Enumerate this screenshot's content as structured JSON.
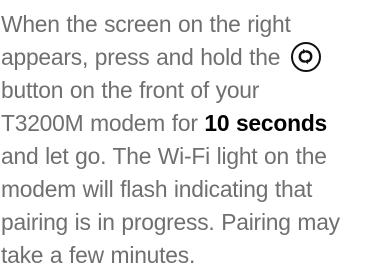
{
  "instructions": {
    "line1": "When the screen on the right",
    "line2": "appears, press and hold the",
    "line3": "button on the front of your",
    "line4_start": "T3200M modem for",
    "line4_bold": "10 seconds",
    "line5": "and let go. The Wi-Fi light on the",
    "line6": "modem will flash indicating that",
    "line7": "pairing is in progress. Pairing may",
    "line8": "take a few minutes."
  },
  "icons": {
    "pairing_button": "wps-pairing-icon"
  },
  "colors": {
    "body_text": "#6f6f6f",
    "emphasis_text": "#000000",
    "icon": "#111111"
  }
}
